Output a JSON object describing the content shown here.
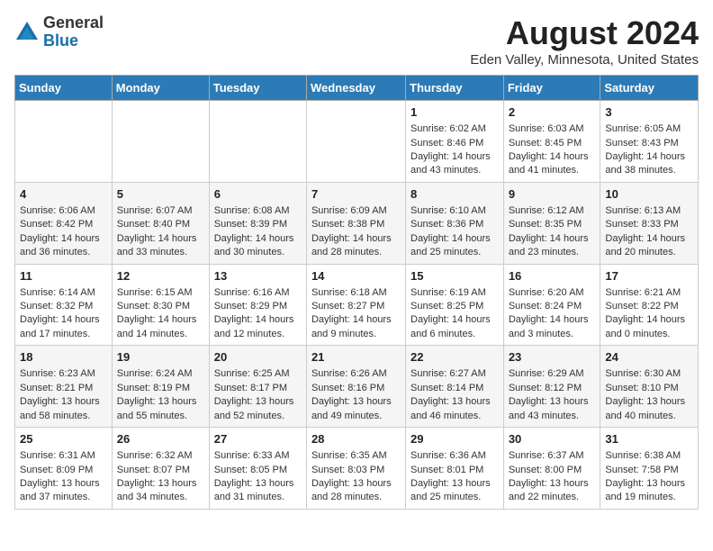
{
  "header": {
    "logo_general": "General",
    "logo_blue": "Blue",
    "month_year": "August 2024",
    "location": "Eden Valley, Minnesota, United States"
  },
  "weekdays": [
    "Sunday",
    "Monday",
    "Tuesday",
    "Wednesday",
    "Thursday",
    "Friday",
    "Saturday"
  ],
  "weeks": [
    [
      {
        "day": "",
        "info": ""
      },
      {
        "day": "",
        "info": ""
      },
      {
        "day": "",
        "info": ""
      },
      {
        "day": "",
        "info": ""
      },
      {
        "day": "1",
        "info": "Sunrise: 6:02 AM\nSunset: 8:46 PM\nDaylight: 14 hours\nand 43 minutes."
      },
      {
        "day": "2",
        "info": "Sunrise: 6:03 AM\nSunset: 8:45 PM\nDaylight: 14 hours\nand 41 minutes."
      },
      {
        "day": "3",
        "info": "Sunrise: 6:05 AM\nSunset: 8:43 PM\nDaylight: 14 hours\nand 38 minutes."
      }
    ],
    [
      {
        "day": "4",
        "info": "Sunrise: 6:06 AM\nSunset: 8:42 PM\nDaylight: 14 hours\nand 36 minutes."
      },
      {
        "day": "5",
        "info": "Sunrise: 6:07 AM\nSunset: 8:40 PM\nDaylight: 14 hours\nand 33 minutes."
      },
      {
        "day": "6",
        "info": "Sunrise: 6:08 AM\nSunset: 8:39 PM\nDaylight: 14 hours\nand 30 minutes."
      },
      {
        "day": "7",
        "info": "Sunrise: 6:09 AM\nSunset: 8:38 PM\nDaylight: 14 hours\nand 28 minutes."
      },
      {
        "day": "8",
        "info": "Sunrise: 6:10 AM\nSunset: 8:36 PM\nDaylight: 14 hours\nand 25 minutes."
      },
      {
        "day": "9",
        "info": "Sunrise: 6:12 AM\nSunset: 8:35 PM\nDaylight: 14 hours\nand 23 minutes."
      },
      {
        "day": "10",
        "info": "Sunrise: 6:13 AM\nSunset: 8:33 PM\nDaylight: 14 hours\nand 20 minutes."
      }
    ],
    [
      {
        "day": "11",
        "info": "Sunrise: 6:14 AM\nSunset: 8:32 PM\nDaylight: 14 hours\nand 17 minutes."
      },
      {
        "day": "12",
        "info": "Sunrise: 6:15 AM\nSunset: 8:30 PM\nDaylight: 14 hours\nand 14 minutes."
      },
      {
        "day": "13",
        "info": "Sunrise: 6:16 AM\nSunset: 8:29 PM\nDaylight: 14 hours\nand 12 minutes."
      },
      {
        "day": "14",
        "info": "Sunrise: 6:18 AM\nSunset: 8:27 PM\nDaylight: 14 hours\nand 9 minutes."
      },
      {
        "day": "15",
        "info": "Sunrise: 6:19 AM\nSunset: 8:25 PM\nDaylight: 14 hours\nand 6 minutes."
      },
      {
        "day": "16",
        "info": "Sunrise: 6:20 AM\nSunset: 8:24 PM\nDaylight: 14 hours\nand 3 minutes."
      },
      {
        "day": "17",
        "info": "Sunrise: 6:21 AM\nSunset: 8:22 PM\nDaylight: 14 hours\nand 0 minutes."
      }
    ],
    [
      {
        "day": "18",
        "info": "Sunrise: 6:23 AM\nSunset: 8:21 PM\nDaylight: 13 hours\nand 58 minutes."
      },
      {
        "day": "19",
        "info": "Sunrise: 6:24 AM\nSunset: 8:19 PM\nDaylight: 13 hours\nand 55 minutes."
      },
      {
        "day": "20",
        "info": "Sunrise: 6:25 AM\nSunset: 8:17 PM\nDaylight: 13 hours\nand 52 minutes."
      },
      {
        "day": "21",
        "info": "Sunrise: 6:26 AM\nSunset: 8:16 PM\nDaylight: 13 hours\nand 49 minutes."
      },
      {
        "day": "22",
        "info": "Sunrise: 6:27 AM\nSunset: 8:14 PM\nDaylight: 13 hours\nand 46 minutes."
      },
      {
        "day": "23",
        "info": "Sunrise: 6:29 AM\nSunset: 8:12 PM\nDaylight: 13 hours\nand 43 minutes."
      },
      {
        "day": "24",
        "info": "Sunrise: 6:30 AM\nSunset: 8:10 PM\nDaylight: 13 hours\nand 40 minutes."
      }
    ],
    [
      {
        "day": "25",
        "info": "Sunrise: 6:31 AM\nSunset: 8:09 PM\nDaylight: 13 hours\nand 37 minutes."
      },
      {
        "day": "26",
        "info": "Sunrise: 6:32 AM\nSunset: 8:07 PM\nDaylight: 13 hours\nand 34 minutes."
      },
      {
        "day": "27",
        "info": "Sunrise: 6:33 AM\nSunset: 8:05 PM\nDaylight: 13 hours\nand 31 minutes."
      },
      {
        "day": "28",
        "info": "Sunrise: 6:35 AM\nSunset: 8:03 PM\nDaylight: 13 hours\nand 28 minutes."
      },
      {
        "day": "29",
        "info": "Sunrise: 6:36 AM\nSunset: 8:01 PM\nDaylight: 13 hours\nand 25 minutes."
      },
      {
        "day": "30",
        "info": "Sunrise: 6:37 AM\nSunset: 8:00 PM\nDaylight: 13 hours\nand 22 minutes."
      },
      {
        "day": "31",
        "info": "Sunrise: 6:38 AM\nSunset: 7:58 PM\nDaylight: 13 hours\nand 19 minutes."
      }
    ]
  ]
}
